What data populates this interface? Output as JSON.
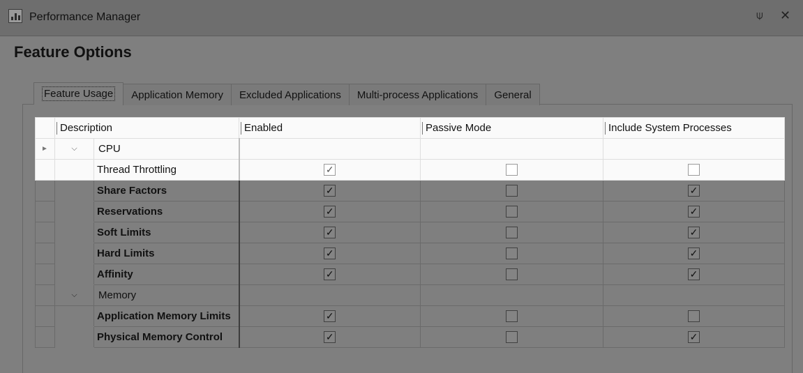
{
  "window": {
    "title": "Performance Manager",
    "app_icon": "chart-icon",
    "pin_icon": "pin-icon",
    "close_icon": "close-icon"
  },
  "page": {
    "heading": "Feature Options"
  },
  "tabs": [
    {
      "label": "Feature Usage",
      "active": true
    },
    {
      "label": "Application Memory",
      "active": false
    },
    {
      "label": "Excluded Applications",
      "active": false
    },
    {
      "label": "Multi-process Applications",
      "active": false
    },
    {
      "label": "General",
      "active": false
    }
  ],
  "grid": {
    "columns": [
      "Description",
      "Enabled",
      "Passive Mode",
      "Include System Processes"
    ],
    "groups": [
      {
        "name": "CPU",
        "expanded": true,
        "rows": [
          {
            "name": "Thread Throttling",
            "enabled": true,
            "passive": false,
            "system": false,
            "highlighted": true
          },
          {
            "name": "Share Factors",
            "enabled": true,
            "passive": false,
            "system": true
          },
          {
            "name": "Reservations",
            "enabled": true,
            "passive": false,
            "system": true
          },
          {
            "name": "Soft Limits",
            "enabled": true,
            "passive": false,
            "system": true
          },
          {
            "name": "Hard Limits",
            "enabled": true,
            "passive": false,
            "system": true
          },
          {
            "name": "Affinity",
            "enabled": true,
            "passive": false,
            "system": true
          }
        ]
      },
      {
        "name": "Memory",
        "expanded": true,
        "rows": [
          {
            "name": "Application Memory Limits",
            "enabled": true,
            "passive": false,
            "system": false
          },
          {
            "name": "Physical Memory Control",
            "enabled": true,
            "passive": false,
            "system": true
          }
        ]
      }
    ]
  }
}
